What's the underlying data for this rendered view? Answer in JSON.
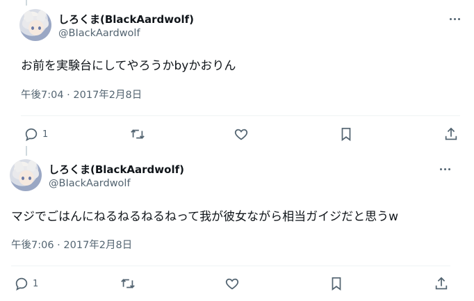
{
  "tweets": [
    {
      "name": "しろくま(BlackAardwolf)",
      "handle": "@BIackAardwolf",
      "text": "お前を実験台にしてやろうかbyかおりん",
      "timestamp": "午後7:04 · 2017年2月8日",
      "reply_count": "1"
    },
    {
      "name": "しろくま(BlackAardwolf)",
      "handle": "@BIackAardwolf",
      "text": "マジでごはんにねるねるねるねって我が彼女ながら相当ガイジだと思うw",
      "timestamp": "午後7:06 · 2017年2月8日",
      "reply_count": "1"
    }
  ],
  "icons": {
    "reply": "reply-icon",
    "retweet": "retweet-icon",
    "like": "heart-icon",
    "bookmark": "bookmark-icon",
    "share": "share-icon",
    "more": "more-icon"
  },
  "colors": {
    "text": "#0f1419",
    "secondary": "#536471",
    "divider": "#eff3f4",
    "thread_line": "#cfd9de"
  }
}
